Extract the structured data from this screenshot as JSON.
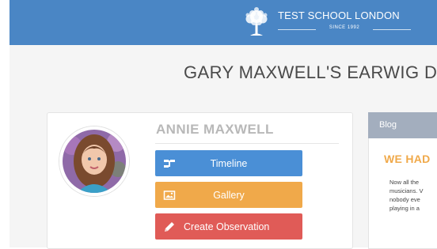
{
  "header": {
    "school_name": "TEST SCHOOL LONDON",
    "since": "SINCE 1992",
    "logo_icon": "tree-icon"
  },
  "page": {
    "title": "GARY MAXWELL'S EARWIG D."
  },
  "profile": {
    "child_name": "ANNIE MAXWELL",
    "avatar": "avatar-photo"
  },
  "actions": [
    {
      "label": "Timeline",
      "icon": "timeline-icon",
      "color": "#4a8fd6"
    },
    {
      "label": "Gallery",
      "icon": "gallery-icon",
      "color": "#f0a94a"
    },
    {
      "label": "Create Observation",
      "icon": "pencil-icon",
      "color": "#e05b57"
    }
  ],
  "blog": {
    "tab_label": "Blog",
    "title": "WE HAD",
    "excerpt_lines": [
      "Now all the",
      "musicians. V",
      "nobody eve",
      "playing in a"
    ]
  },
  "colors": {
    "header_bg": "#4a86c5",
    "accent_orange": "#f0a94a"
  }
}
